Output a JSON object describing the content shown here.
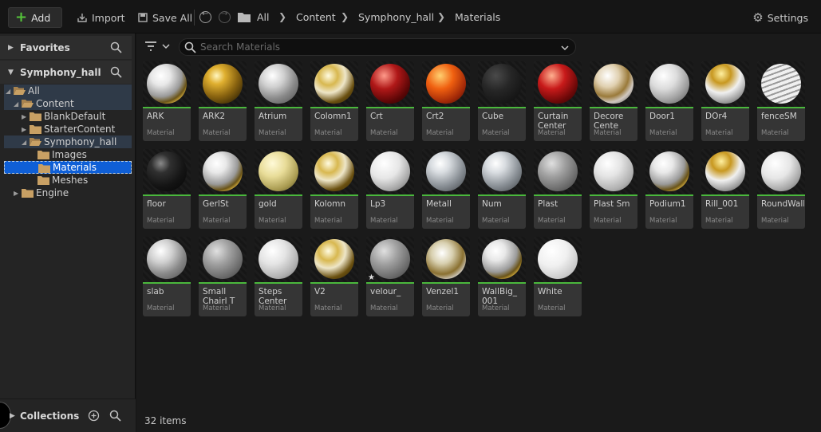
{
  "toolbar": {
    "add_label": "Add",
    "import_label": "Import",
    "save_all_label": "Save All",
    "breadcrumb": [
      "All",
      "Content",
      "Symphony_hall",
      "Materials"
    ],
    "settings_label": "Settings"
  },
  "left_panel": {
    "favorites_label": "Favorites",
    "project_label": "Symphony_hall",
    "tree": [
      {
        "label": "All",
        "level": 0,
        "expanded": true
      },
      {
        "label": "Content",
        "level": 1,
        "expanded": true
      },
      {
        "label": "BlankDefault",
        "level": 2,
        "expanded": false
      },
      {
        "label": "StarterContent",
        "level": 2,
        "expanded": false
      },
      {
        "label": "Symphony_hall",
        "level": 2,
        "expanded": true
      },
      {
        "label": "Images",
        "level": 3
      },
      {
        "label": "Materials",
        "level": 3,
        "selected": true
      },
      {
        "label": "Meshes",
        "level": 3
      },
      {
        "label": "Engine",
        "level": 1,
        "expanded": false
      }
    ],
    "collections_label": "Collections"
  },
  "main": {
    "search_placeholder": "Search Materials",
    "assets": [
      {
        "name": "ARK",
        "type": "Material",
        "style": "whitegold"
      },
      {
        "name": "ARK2",
        "type": "Material",
        "style": "gold"
      },
      {
        "name": "Atrium",
        "type": "Material",
        "style": "marble"
      },
      {
        "name": "Colomn1",
        "type": "Material",
        "style": "goldmarble"
      },
      {
        "name": "Crt",
        "type": "Material",
        "style": "redswirl"
      },
      {
        "name": "Crt2",
        "type": "Material",
        "style": "orange"
      },
      {
        "name": "Cube",
        "type": "Material",
        "style": "black"
      },
      {
        "name": "Curtain Center",
        "type": "Material",
        "style": "redpattern"
      },
      {
        "name": "Decore Cente",
        "type": "Material",
        "style": "decor"
      },
      {
        "name": "Door1",
        "type": "Material",
        "style": "wood"
      },
      {
        "name": "DOr4",
        "type": "Material",
        "style": "goldtop"
      },
      {
        "name": "fenceSM",
        "type": "Material",
        "style": "stripes"
      },
      {
        "name": "floor",
        "type": "Material",
        "style": "darkgloss"
      },
      {
        "name": "GerlSt",
        "type": "Material",
        "style": "whitegold"
      },
      {
        "name": "gold",
        "type": "Material",
        "style": "palegold"
      },
      {
        "name": "Kolomn",
        "type": "Material",
        "style": "goldmarble"
      },
      {
        "name": "Lp3",
        "type": "Material",
        "style": "speckle"
      },
      {
        "name": "Metall",
        "type": "Material",
        "style": "silver"
      },
      {
        "name": "Num",
        "type": "Material",
        "style": "silver"
      },
      {
        "name": "Plast",
        "type": "Material",
        "style": "grey"
      },
      {
        "name": "Plast Sm",
        "type": "Material",
        "style": "lightgrey"
      },
      {
        "name": "Podium1",
        "type": "Material",
        "style": "whitegold"
      },
      {
        "name": "Rill_001",
        "type": "Material",
        "style": "goldtop"
      },
      {
        "name": "RoundWall",
        "type": "Material",
        "style": "speckle"
      },
      {
        "name": "slab",
        "type": "Material",
        "style": "marble"
      },
      {
        "name": "Small Chairl T",
        "type": "Material",
        "style": "grey"
      },
      {
        "name": "Steps Center",
        "type": "Material",
        "style": "lightgrey"
      },
      {
        "name": "V2",
        "type": "Material",
        "style": "goldmarble"
      },
      {
        "name": "velour_",
        "type": "Material",
        "style": "grey",
        "star": true
      },
      {
        "name": "Venzel1",
        "type": "Material",
        "style": "silvergold"
      },
      {
        "name": "WallBig_ 001",
        "type": "Material",
        "style": "whitegold"
      },
      {
        "name": "White",
        "type": "Material",
        "style": "white"
      }
    ],
    "status": "32 items"
  },
  "colors": {
    "accent_green": "#4ab83c",
    "selection_blue": "#0f5fd6",
    "folder": "#c8a064"
  }
}
